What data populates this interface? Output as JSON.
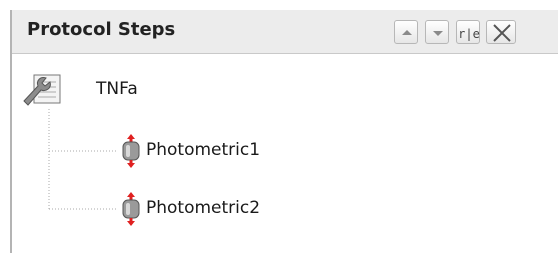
{
  "panel": {
    "title": "Protocol Steps",
    "toolbar": {
      "move_up_icon": "arrow-up",
      "move_down_icon": "arrow-down",
      "swap_icon": "swap-r-e",
      "swap_glyph": "r|e",
      "close_icon": "close-x"
    }
  },
  "tree": {
    "root": {
      "label": "TNFa",
      "icon": "wrench-document"
    },
    "children": [
      {
        "label": "Photometric1",
        "icon": "photometric-vial"
      },
      {
        "label": "Photometric2",
        "icon": "photometric-vial"
      }
    ]
  },
  "colors": {
    "header_bg": "#ececec",
    "accent_red": "#e02020",
    "vial_gray": "#8a8a8a"
  }
}
